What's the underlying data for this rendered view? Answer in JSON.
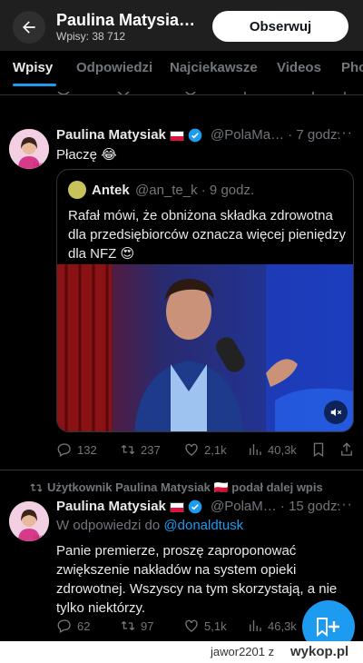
{
  "header": {
    "title": "Paulina Matysia…",
    "posts_count": "Wpisy: 38 712",
    "follow_label": "Obserwuj"
  },
  "tabs": [
    {
      "label": "Wpisy",
      "active": true
    },
    {
      "label": "Odpowiedzi",
      "active": false
    },
    {
      "label": "Najciekawsze",
      "active": false
    },
    {
      "label": "Videos",
      "active": false
    },
    {
      "label": "Pho",
      "active": false
    }
  ],
  "tweet1": {
    "name": "Paulina Matysiak",
    "handle_time": "@PolaMa… · 7 godz.",
    "text": "Płaczę 😂",
    "quote": {
      "name": "Antek",
      "handle_time": "@an_te_k · 9 godz.",
      "text": "Rafał mówi, że obniżona składka zdrowotna dla przedsiębiorców oznacza więcej pieniędzy dla NFZ 😍"
    },
    "stats": {
      "replies": "132",
      "retweets": "237",
      "likes": "2,1k",
      "views": "40,3k"
    }
  },
  "repost_note": "Użytkownik Paulina Matysiak 🇵🇱 podał dalej wpis",
  "tweet2": {
    "name": "Paulina Matysiak",
    "handle_time": "@PolaM… · 15 godz.",
    "reply_prefix": "W odpowiedzi do",
    "reply_to": "@donaldtusk",
    "text": "Panie premierze, proszę zaproponować zwiększenie nakładów na system opieki zdrowotnej. Wszyscy na tym skorzystają, a nie tylko niektórzy.",
    "stats": {
      "replies": "62",
      "retweets": "97",
      "likes": "5,1k",
      "views": "46,3k"
    }
  },
  "watermark": {
    "text": "jawor2201  z",
    "logo": "wykop.pl"
  },
  "colors": {
    "accent": "#1d9bf0",
    "background": "#000000",
    "muted": "#71767b",
    "header": "#1f1f1f"
  }
}
